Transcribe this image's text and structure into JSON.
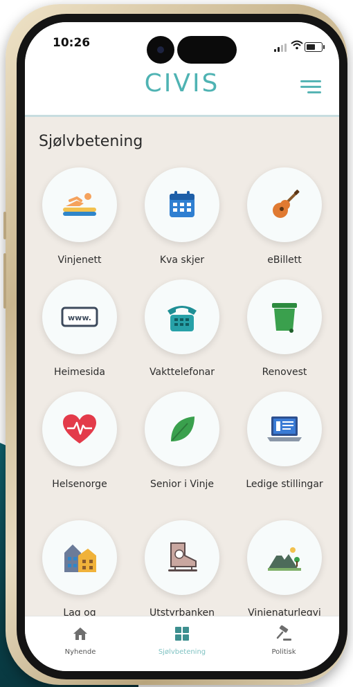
{
  "status_bar": {
    "time": "10:26"
  },
  "header": {
    "logo": "CIVIS"
  },
  "section": {
    "title": "Sjølvbetening"
  },
  "tiles": [
    {
      "label": "Vinjenett",
      "icon": "swimmer-icon"
    },
    {
      "label": "Kva skjer",
      "icon": "calendar-icon"
    },
    {
      "label": "eBillett",
      "icon": "guitar-icon"
    },
    {
      "label": "Heimesida",
      "icon": "www-browser-icon"
    },
    {
      "label": "Vakttelefonar",
      "icon": "telephone-icon"
    },
    {
      "label": "Renovest",
      "icon": "trash-bin-icon"
    },
    {
      "label": "Helsenorge",
      "icon": "heart-pulse-icon"
    },
    {
      "label": "Senior i Vinje",
      "icon": "leaf-icon"
    },
    {
      "label": "Ledige stillingar",
      "icon": "laptop-icon"
    },
    {
      "label": "Lag og",
      "icon": "buildings-icon"
    },
    {
      "label": "Utstyrbanken",
      "icon": "ice-skate-icon"
    },
    {
      "label": "Vinjenaturlegvi",
      "icon": "mountain-icon"
    }
  ],
  "bottom_nav": [
    {
      "label": "Nyhende",
      "icon": "home-icon",
      "active": false
    },
    {
      "label": "Sjølvbetening",
      "icon": "grid-icon",
      "active": true
    },
    {
      "label": "Politisk",
      "icon": "gavel-icon",
      "active": false
    }
  ],
  "colors": {
    "accent": "#4fb3b3",
    "screen_bg": "#f0ebe5",
    "nav_active": "#7fc2c2"
  }
}
